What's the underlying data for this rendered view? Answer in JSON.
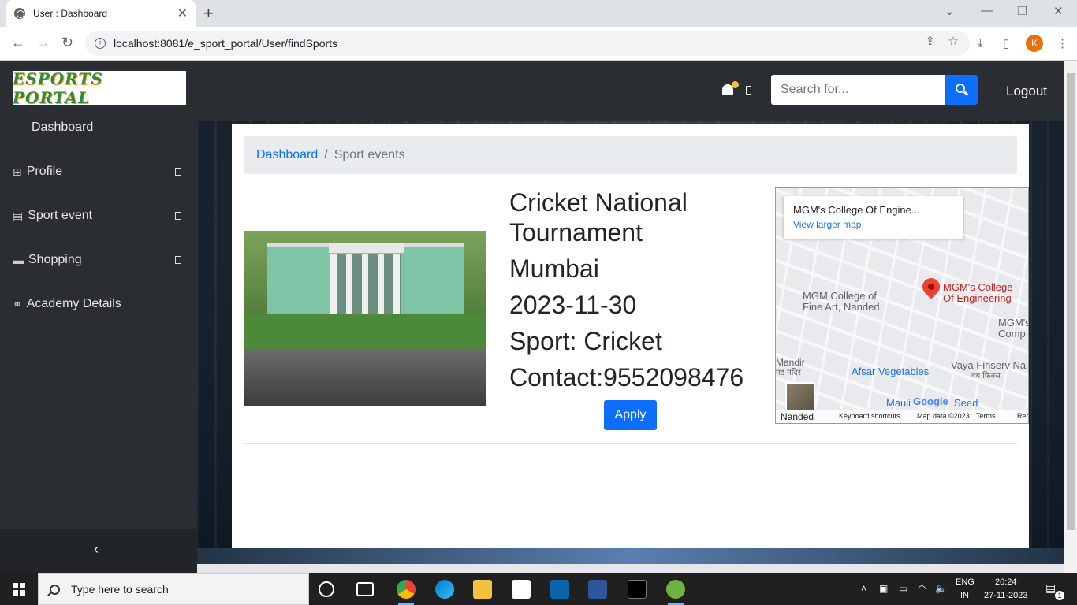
{
  "browser": {
    "tab_title": "User : Dashboard",
    "tab_close": "✕",
    "new_tab": "+",
    "url": "localhost:8081/e_sport_portal/User/findSports",
    "profile_initial": "K"
  },
  "header": {
    "logo_text": "ESPORTS PORTAL",
    "search_placeholder": "Search for...",
    "logout_label": "Logout"
  },
  "sidebar": {
    "items": [
      {
        "label": "Dashboard",
        "icon": "none"
      },
      {
        "label": "Profile",
        "icon": "sitemap-icon"
      },
      {
        "label": "Sport event",
        "icon": "table-icon"
      },
      {
        "label": "Shopping",
        "icon": "bag-icon"
      },
      {
        "label": "Academy Details",
        "icon": "link-icon"
      }
    ],
    "collapse": "‹"
  },
  "breadcrumb": {
    "home": "Dashboard",
    "separator": "/",
    "current": "Sport events"
  },
  "event": {
    "title": "Cricket National Tournament",
    "city": "Mumbai",
    "date": "2023-11-30",
    "sport": "Sport: Cricket",
    "contact": "Contact:9552098476",
    "apply_label": "Apply"
  },
  "map": {
    "place_title": "MGM's College Of Engine...",
    "larger_map": "View larger map",
    "pin_label_1": "MGM's College",
    "pin_label_2": "Of Engineering",
    "label_fine_art_1": "MGM College of",
    "label_fine_art_2": "Fine Art, Nanded",
    "label_mgm_1": "MGM's",
    "label_mgm_2": "Comp",
    "label_mandir_1": "Mandir",
    "label_mandir_2": "गड मंदिर",
    "label_afsar": "Afsar Vegetables",
    "label_vaya_1": "Vaya Finserv Na",
    "label_vaya_2": "वय फिनस",
    "label_mauli": "Mauli",
    "label_seed": "Seed",
    "label_nanded": "Nanded",
    "google": "Google",
    "keyboard": "Keyboard shortcuts",
    "map_data": "Map data ©2023",
    "terms": "Terms",
    "report": "Rep"
  },
  "taskbar": {
    "search_placeholder": "Type here to search",
    "lang_1": "ENG",
    "lang_2": "IN",
    "time": "20:24",
    "date": "27-11-2023",
    "notif_count": "1"
  }
}
